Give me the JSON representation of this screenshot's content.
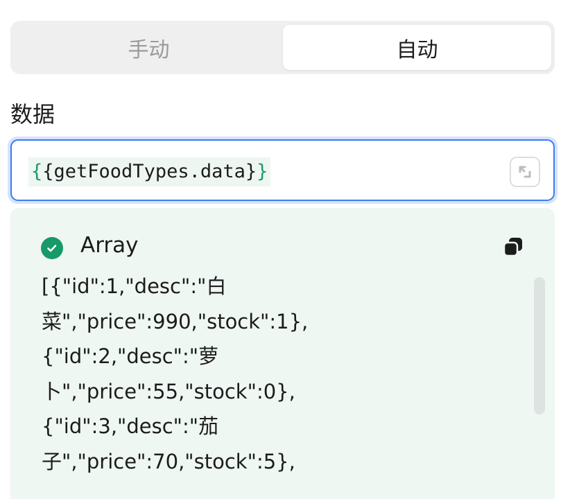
{
  "mode_toggle": {
    "options": [
      "手动",
      "自动"
    ],
    "selected": "自动"
  },
  "field": {
    "label": "数据",
    "value_open": "{",
    "value_inner": "{getFoodTypes.data}",
    "value_close": "}",
    "expand_icon": "expand-icon"
  },
  "result": {
    "status_icon": "check-circle-icon",
    "status_color": "#17996a",
    "type": "Array",
    "copy_icon": "copy-icon",
    "lines": [
      "[{\"id\":1,\"desc\":\"白",
      "菜\",\"price\":990,\"stock\":1},",
      "{\"id\":2,\"desc\":\"萝",
      "卜\",\"price\":55,\"stock\":0},",
      "{\"id\":3,\"desc\":\"茄",
      "子\",\"price\":70,\"stock\":5},"
    ]
  },
  "colors": {
    "accent": "#3b7cf2",
    "success": "#17996a",
    "panel_bg": "#eff7f3"
  }
}
